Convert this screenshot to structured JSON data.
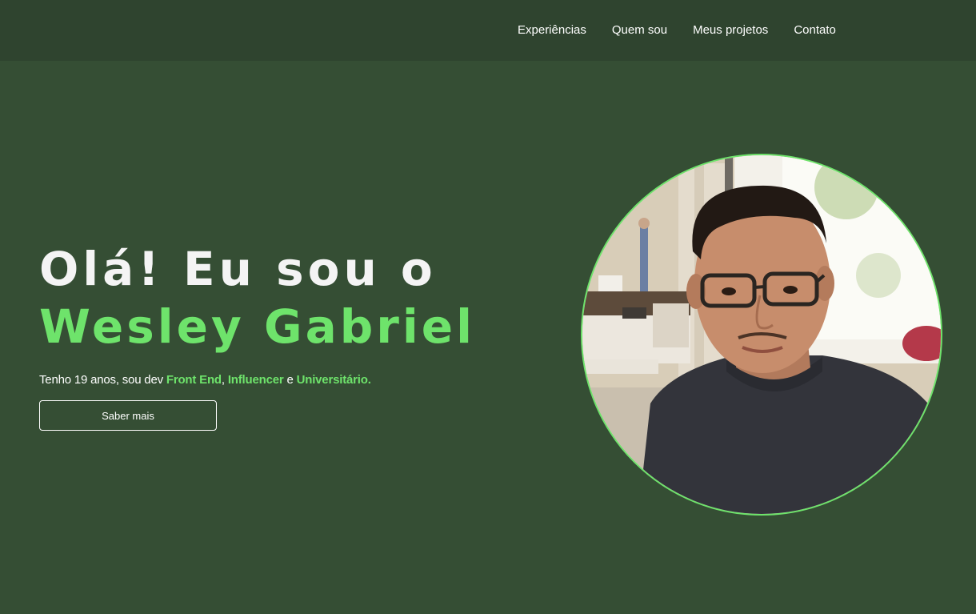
{
  "nav": {
    "items": [
      {
        "label": "Experiências"
      },
      {
        "label": "Quem sou"
      },
      {
        "label": "Meus projetos"
      },
      {
        "label": "Contato"
      }
    ]
  },
  "hero": {
    "greeting": "Olá! Eu sou o",
    "name": "Wesley Gabriel",
    "tagline_prefix": "Tenho 19 anos, sou dev ",
    "tagline_role1": "Front End",
    "tagline_sep1": ", ",
    "tagline_role2": "Influencer",
    "tagline_sep2": " e ",
    "tagline_role3": "Universitário.",
    "cta_label": "Saber mais"
  },
  "profile_photo": {
    "alt": "Wesley Gabriel"
  },
  "colors": {
    "background": "#354e34",
    "navbar": "#2f442f",
    "accent": "#6ee36b",
    "text": "#ffffff"
  }
}
